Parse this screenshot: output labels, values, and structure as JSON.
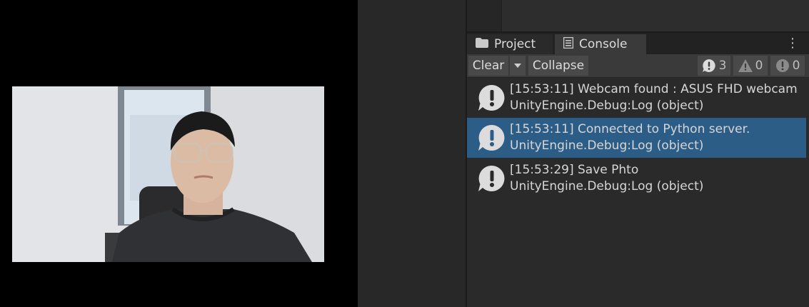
{
  "tabs": {
    "project": "Project",
    "console": "Console"
  },
  "toolbar": {
    "clear": "Clear",
    "collapse": "Collapse",
    "log_count": "3",
    "warning_count": "0",
    "error_count": "0"
  },
  "logs": [
    {
      "line1": "[15:53:11] Webcam found : ASUS FHD webcam",
      "line2": "UnityEngine.Debug:Log (object)",
      "selected": false
    },
    {
      "line1": "[15:53:11] Connected to Python server.",
      "line2": "UnityEngine.Debug:Log (object)",
      "selected": true
    },
    {
      "line1": "[15:53:29] Save Phto",
      "line2": "UnityEngine.Debug:Log (object)",
      "selected": false
    }
  ],
  "colors": {
    "selection": "#2c5d87",
    "panel": "#2a2a2a",
    "toolbar": "#3a3a3a"
  },
  "icons": {
    "project_tab": "folder-icon",
    "console_tab": "console-icon",
    "log": "info-bubble-icon",
    "warning": "warning-icon",
    "error": "error-icon",
    "menu": "kebab-menu-icon"
  }
}
